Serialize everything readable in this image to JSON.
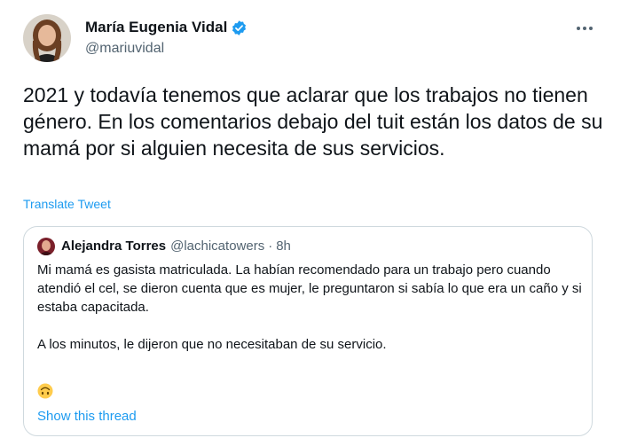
{
  "author": {
    "name": "María Eugenia Vidal",
    "handle": "@mariuvidal",
    "verified": true,
    "avatar_icon": "user-avatar-photo"
  },
  "tweet": {
    "text": "2021 y todavía tenemos que aclarar que los trabajos no tienen género. En los comentarios debajo del tuit están los datos de su mamá por si alguien necesita de sus servicios.",
    "translate_label": "Translate Tweet"
  },
  "quoted": {
    "name": "Alejandra Torres",
    "handle": "@lachicatowers",
    "separator": "·",
    "time": "8h",
    "paragraph1": "Mi mamá es gasista matriculada. La habían recomendado para un trabajo pero cuando atendió el cel, se dieron cuenta que es mujer, le preguntaron si sabía lo que era un caño y si estaba capacitada.",
    "paragraph2": "A los minutos, le dijeron que no necesitaban de su servicio.",
    "emoji_icon": "upside-down-face-icon",
    "show_thread_label": "Show this thread"
  },
  "colors": {
    "accent": "#1d9bf0",
    "text": "#0f1419",
    "secondary": "#536471",
    "border": "#cfd9de"
  }
}
